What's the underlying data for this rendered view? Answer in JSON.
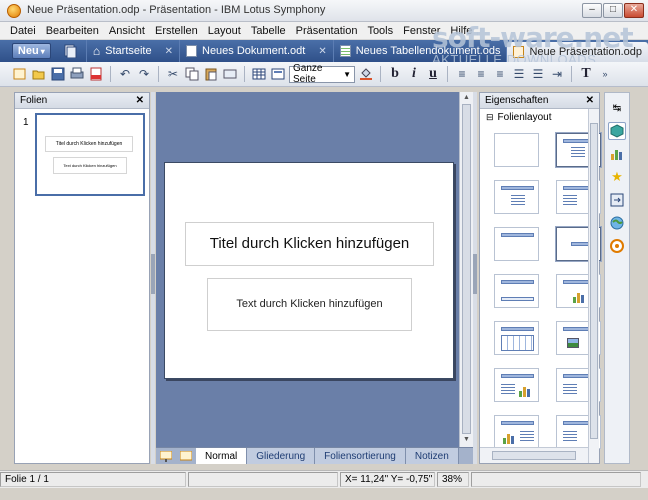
{
  "window": {
    "title": "Neue Präsentation.odp - Präsentation - IBM Lotus Symphony",
    "controls": {
      "minimize": "–",
      "maximize": "□",
      "close": "✕"
    }
  },
  "menu": [
    "Datei",
    "Bearbeiten",
    "Ansicht",
    "Erstellen",
    "Layout",
    "Tabelle",
    "Präsentation",
    "Tools",
    "Fenster",
    "Hilfe"
  ],
  "tabs": {
    "new_label": "Neu",
    "items": [
      {
        "label": "Startseite",
        "icon": "home-icon"
      },
      {
        "label": "Neues Dokument.odt",
        "icon": "document-icon"
      },
      {
        "label": "Neues Tabellendokument.ods",
        "icon": "spreadsheet-icon"
      },
      {
        "label": "Neue Präsentation.odp",
        "icon": "presentation-icon",
        "active": true
      }
    ],
    "close_glyph": "✕"
  },
  "toolbar": {
    "page_view": "Ganze Seite",
    "bold": "b",
    "italic": "i",
    "underline": "u",
    "text_tool": "T"
  },
  "slides_panel": {
    "title": "Folien",
    "close": "✕",
    "slides": [
      {
        "number": "1",
        "title_text": "Titel durch Klicken hinzufügen",
        "body_text": "Text durch Klicken hinzufügen"
      }
    ]
  },
  "slide": {
    "title_placeholder": "Titel durch Klicken hinzufügen",
    "text_placeholder": "Text durch Klicken hinzufügen"
  },
  "view_tabs": [
    "Normal",
    "Gliederung",
    "Foliensortierung",
    "Notizen"
  ],
  "properties": {
    "title": "Eigenschaften",
    "close": "✕",
    "section": "Folienlayout"
  },
  "status": {
    "slide_counter": "Folie 1 / 1",
    "coordinates": "X= 11,24\" Y= -0,75\"",
    "zoom": "38%"
  },
  "watermark": {
    "main": "soft-ware.net",
    "sub": "AKTUELLE DOWNLOADS"
  },
  "colors": {
    "tab_bar": "#3a5c96",
    "edit_background": "#6a7fa8",
    "accent": "#4a6ea8"
  }
}
